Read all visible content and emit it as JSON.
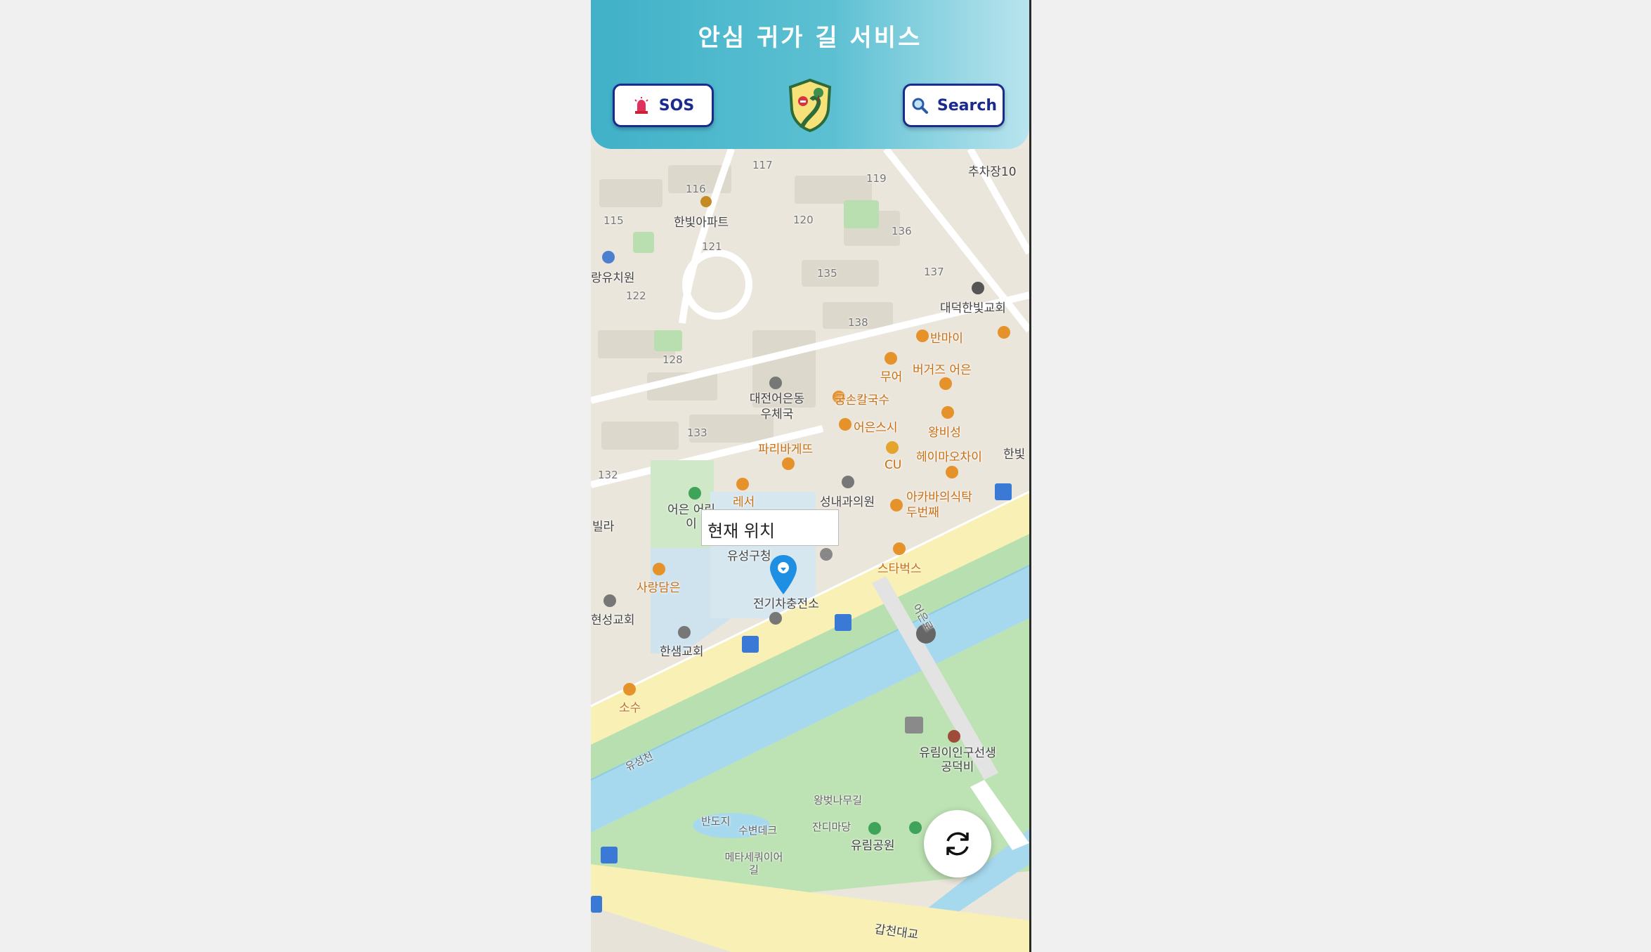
{
  "header": {
    "title": "안심 귀가 길 서비스",
    "sos_label": "SOS",
    "search_label": "Search"
  },
  "map": {
    "current_location_label": "현재 위치",
    "labels": [
      {
        "id": "num-117",
        "text": "117"
      },
      {
        "id": "num-116",
        "text": "116"
      },
      {
        "id": "num-119",
        "text": "119"
      },
      {
        "id": "num-115",
        "text": "115"
      },
      {
        "id": "num-120",
        "text": "120"
      },
      {
        "id": "num-136",
        "text": "136"
      },
      {
        "id": "num-121",
        "text": "121"
      },
      {
        "id": "num-135",
        "text": "135"
      },
      {
        "id": "num-137",
        "text": "137"
      },
      {
        "id": "num-122",
        "text": "122"
      },
      {
        "id": "num-138",
        "text": "138"
      },
      {
        "id": "num-128",
        "text": "128"
      },
      {
        "id": "num-133",
        "text": "133"
      },
      {
        "id": "num-132",
        "text": "132"
      },
      {
        "id": "hanbit-apt",
        "text": "한빛아파트"
      },
      {
        "id": "parking",
        "text": "추차장10"
      },
      {
        "id": "kindergarten",
        "text": "랑유치원"
      },
      {
        "id": "church-daedeok",
        "text": "대덕한빛교회"
      },
      {
        "id": "banmai",
        "text": "반마이"
      },
      {
        "id": "mueo",
        "text": "무어"
      },
      {
        "id": "burgers",
        "text": "버거즈 어은"
      },
      {
        "id": "post-office",
        "text": "대전어은동 우체국"
      },
      {
        "id": "gungson",
        "text": "궁손칼국수"
      },
      {
        "id": "eoeun-sushi",
        "text": "어은스시"
      },
      {
        "id": "wangbiseong",
        "text": "왕비성"
      },
      {
        "id": "paris",
        "text": "파리바게뜨"
      },
      {
        "id": "cu",
        "text": "CU"
      },
      {
        "id": "heimao",
        "text": "헤이마오차이"
      },
      {
        "id": "han",
        "text": "한빛"
      },
      {
        "id": "lesser",
        "text": "레서"
      },
      {
        "id": "eoeun-kinder",
        "text": "어은 어린이"
      },
      {
        "id": "seongnae",
        "text": "성내과의원"
      },
      {
        "id": "akabane",
        "text": "아카바의식탁 두번째"
      },
      {
        "id": "villa",
        "text": "빌라"
      },
      {
        "id": "yuseong-gu",
        "text": "유성구청"
      },
      {
        "id": "starbucks",
        "text": "스타벅스"
      },
      {
        "id": "sarangdameun",
        "text": "사랑담은"
      },
      {
        "id": "charging",
        "text": "전기차충전소"
      },
      {
        "id": "seongchurch",
        "text": "현성교회"
      },
      {
        "id": "hansaem",
        "text": "한샘교회"
      },
      {
        "id": "sosu",
        "text": "소수"
      },
      {
        "id": "eoeun-road",
        "text": "어은로"
      },
      {
        "id": "yuseong-stream",
        "text": "유성천"
      },
      {
        "id": "yurim-center",
        "text": "유림이인구선생 공덕비"
      },
      {
        "id": "wangbeot",
        "text": "왕벚나무길"
      },
      {
        "id": "bandoji",
        "text": "반도지"
      },
      {
        "id": "subyeon",
        "text": "수변데크"
      },
      {
        "id": "jandi",
        "text": "잔디마당"
      },
      {
        "id": "yurim-park",
        "text": "유림공원"
      },
      {
        "id": "metasequoia",
        "text": "메타세쿼이어 길"
      },
      {
        "id": "gapcheon-bridge",
        "text": "갑천대교"
      }
    ]
  },
  "icons": {
    "sos": "siren-icon",
    "search": "magnifier-icon",
    "logo": "shield-logo-icon",
    "marker": "location-pin-icon",
    "refresh": "refresh-icon"
  }
}
